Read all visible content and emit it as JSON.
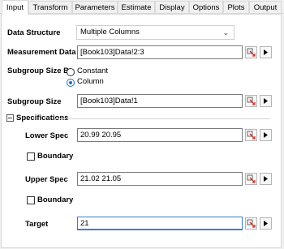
{
  "tabs": [
    {
      "label": "Input",
      "active": true
    },
    {
      "label": "Transform"
    },
    {
      "label": "Parameters"
    },
    {
      "label": "Estimate"
    },
    {
      "label": "Display"
    },
    {
      "label": "Options"
    },
    {
      "label": "Plots"
    },
    {
      "label": "Output"
    }
  ],
  "form": {
    "data_structure_label": "Data Structure",
    "data_structure_value": "Multiple Columns",
    "measurement_label": "Measurement Data",
    "measurement_value": "[Book103]Data!2:3",
    "subgroup_by_label": "Subgroup Size By",
    "opt_constant": "Constant",
    "opt_column": "Column",
    "subgroup_size_label": "Subgroup Size",
    "subgroup_size_value": "[Book103]Data!1",
    "specs_label": "Specifications",
    "lower_spec_label": "Lower Spec",
    "lower_spec_value": "20.99 20.95",
    "boundary1_label": "Boundary",
    "upper_spec_label": "Upper Spec",
    "upper_spec_value": "21.02 21.05",
    "boundary2_label": "Boundary",
    "target_label": "Target",
    "target_value": "21"
  },
  "icons": {
    "range_select": "range-select-icon",
    "arrow_menu": "arrow-right-icon"
  },
  "colors": {
    "accent": "#1a6fd6",
    "range_icon_red": "#d0342c"
  }
}
